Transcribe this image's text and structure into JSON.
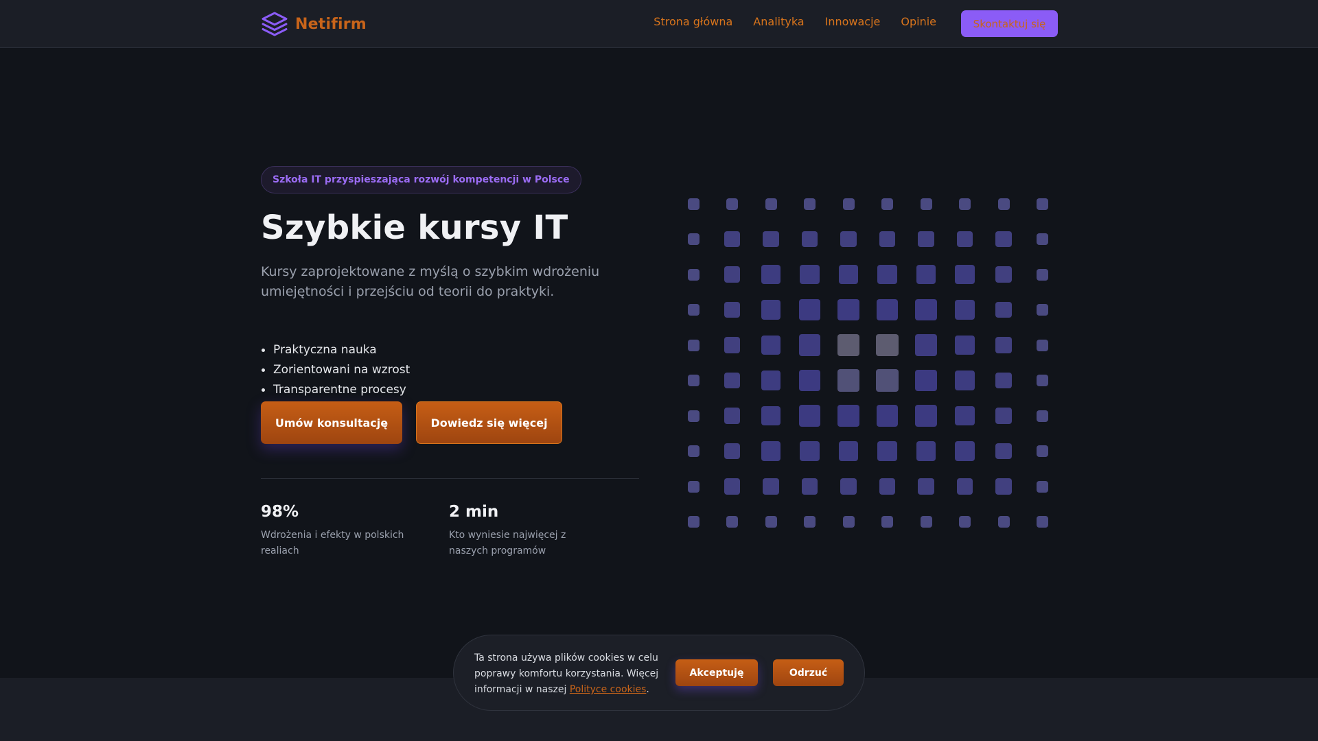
{
  "nav": {
    "brand": "Netifirm",
    "links": [
      "Strona główna",
      "Analityka",
      "Innowacje",
      "Opinie"
    ],
    "cta": "Skontaktuj się"
  },
  "hero": {
    "badge": "Szkoła IT przyspieszająca rozwój kompetencji w Polsce",
    "title": "Szybkie kursy IT",
    "subtitle": "Kursy zaprojektowane z myślą o szybkim wdrożeniu umiejętności i przejściu od teorii do praktyki.",
    "features": [
      "Praktyczna nauka",
      "Zorientowani na wzrost",
      "Transparentne procesy"
    ],
    "primary_button": "Umów konsultację",
    "secondary_button": "Dowiedz się więcej"
  },
  "stats": [
    {
      "value": "98%",
      "label": "Wdrożenia i efekty w polskich realiach"
    },
    {
      "value": "2 min",
      "label": "Kto wyniesie najwięcej z naszych programów"
    }
  ],
  "cookie": {
    "text": "Ta strona używa plików cookies w celu poprawy komfortu korzystania. Więcej informacji w naszej ",
    "link": "Polityce cookies",
    "after": ".",
    "accept": "Akceptuję",
    "reject": "Odrzuć"
  },
  "colors": {
    "accent": "#c8641a",
    "purple": "#8b5cf6",
    "background": "#11141a",
    "navbar": "#1b1e26"
  },
  "icons": {
    "logo": "layers-icon"
  }
}
